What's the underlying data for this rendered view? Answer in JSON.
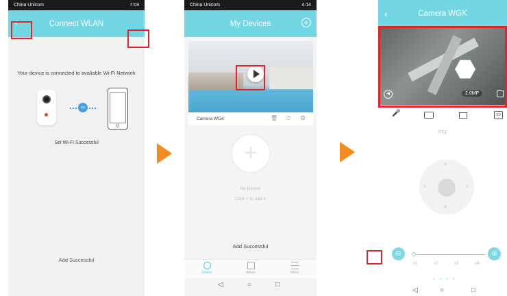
{
  "phone1": {
    "status": {
      "carrier": "China Unicom",
      "signal": "ᵃˡˡ ✉",
      "time": "7:03"
    },
    "title": "Connect WLAN",
    "back": "‹",
    "message": "Your device is connected to avaliable Wi-Fi Network",
    "success": "Set Wi-Fi Successful",
    "bottom": "Add Successful"
  },
  "phone2": {
    "status": {
      "carrier": "China Unicom",
      "time": "4:14"
    },
    "title": "My Devices",
    "add": "+",
    "camera_name": "Camera WGK",
    "no_device": "No Device",
    "hint": "Click + to add it",
    "toast": "Add Successful",
    "tabs": [
      {
        "label": "Device"
      },
      {
        "label": "Album"
      },
      {
        "label": "Menu"
      }
    ],
    "accent": "#55cbdc"
  },
  "phone3": {
    "title": "Camera WGK",
    "back": "‹",
    "resolution": "2.0MP",
    "sd": "SD",
    "ptz": "PTZ",
    "zoom_levels": [
      "x1",
      "x2",
      "x3",
      "x4"
    ]
  },
  "colors": {
    "teal": "#72d6e3",
    "orange": "#f28c1e",
    "red": "#e3232a"
  }
}
